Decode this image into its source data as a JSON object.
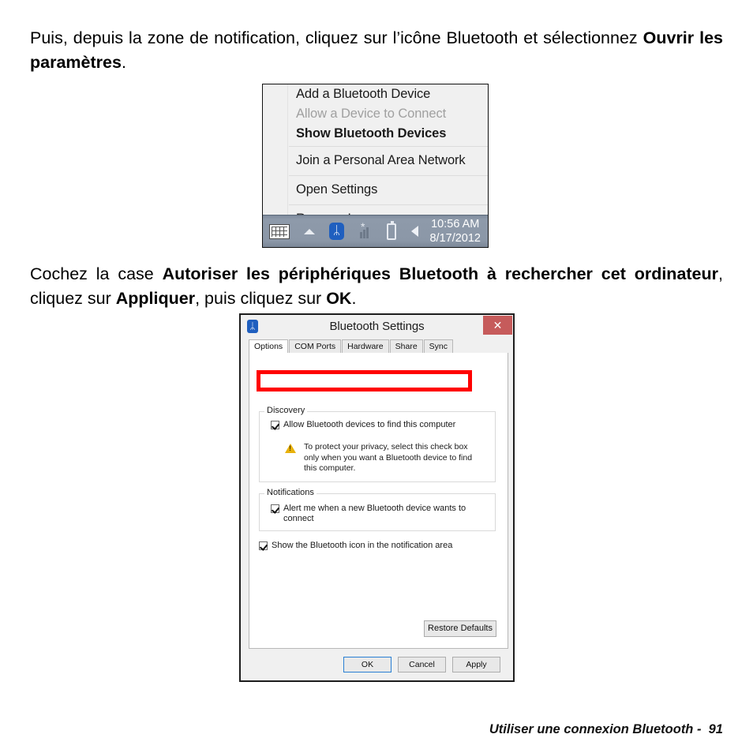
{
  "page": {
    "paragraph1_parts": [
      {
        "text": "Puis, depuis la zone de notification, cliquez sur l’icône Bluetooth et sélectionnez ",
        "bold": false
      },
      {
        "text": "Ouvrir les paramètres",
        "bold": true
      },
      {
        "text": ".",
        "bold": false
      }
    ],
    "paragraph2_parts": [
      {
        "text": "Cochez la case ",
        "bold": false
      },
      {
        "text": "Autoriser les périphériques Bluetooth à rechercher cet ordinateur",
        "bold": true
      },
      {
        "text": ", cliquez sur ",
        "bold": false
      },
      {
        "text": "Appliquer",
        "bold": true
      },
      {
        "text": ", puis cliquez sur ",
        "bold": false
      },
      {
        "text": "OK",
        "bold": true
      },
      {
        "text": ".",
        "bold": false
      }
    ],
    "footer": "Utiliser une connexion Bluetooth -  91"
  },
  "context_menu": {
    "items": [
      {
        "label": "Add a Bluetooth Device",
        "state": "normal",
        "separator_after": false
      },
      {
        "label": "Allow a Device to Connect",
        "state": "disabled",
        "separator_after": false
      },
      {
        "label": "Show Bluetooth Devices",
        "state": "bold",
        "separator_after": true
      },
      {
        "label": "Join a Personal Area Network",
        "state": "normal",
        "separator_after": true
      },
      {
        "label": "Open Settings",
        "state": "normal",
        "separator_after": true
      },
      {
        "label": "Remove Icon",
        "state": "normal",
        "separator_after": false
      }
    ]
  },
  "tray": {
    "keyboard_icon": "keyboard-icon",
    "chevron_icon": "show-hidden-icons-chevron",
    "bluetooth_glyph": "ᛦ",
    "signal_glyph": "*",
    "battery_icon": "battery-icon",
    "volume_icon": "volume-icon",
    "time": "10:56 AM",
    "date": "8/17/2012",
    "background_color": "#8b97a7"
  },
  "dialog": {
    "title": "Bluetooth Settings",
    "bluetooth_glyph": "ᛦ",
    "close_label": "✕",
    "close_color": "#c65b5b",
    "tabs": [
      {
        "label": "Options",
        "active": true
      },
      {
        "label": "COM Ports",
        "active": false
      },
      {
        "label": "Hardware",
        "active": false
      },
      {
        "label": "Share",
        "active": false
      },
      {
        "label": "Sync",
        "active": false
      }
    ],
    "discovery": {
      "group_label": "Discovery",
      "checkbox_label": "Allow Bluetooth devices to find this computer",
      "checkbox_checked": true,
      "warning_text": "To protect your privacy, select this check box only when you want a Bluetooth device to find this computer."
    },
    "notifications": {
      "group_label": "Notifications",
      "checkbox_label": "Alert me when a new Bluetooth device wants to connect",
      "checkbox_checked": true
    },
    "show_icon": {
      "checkbox_label": "Show the Bluetooth icon in the notification area",
      "checkbox_checked": true
    },
    "restore_defaults_label": "Restore Defaults",
    "buttons": [
      {
        "label": "OK",
        "default": true
      },
      {
        "label": "Cancel",
        "default": false
      },
      {
        "label": "Apply",
        "default": false
      }
    ]
  },
  "annotation": {
    "highlight_color": "#ff0000",
    "target": "Allow Bluetooth devices to find this computer"
  }
}
